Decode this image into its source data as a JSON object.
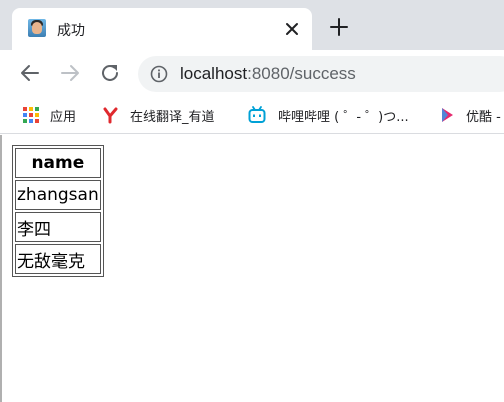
{
  "tab": {
    "title": "成功",
    "favicon": "avatar-icon"
  },
  "toolbar": {
    "url_host": "localhost",
    "url_rest": ":8080/success"
  },
  "bookmarks": [
    {
      "label": "应用",
      "icon": "apps-grid-icon"
    },
    {
      "label": "在线翻译_有道",
      "icon": "youdao-icon"
    },
    {
      "label": "哔哩哔哩 ( ゜- ゜)つ...",
      "icon": "bilibili-icon"
    },
    {
      "label": "优酷 -",
      "icon": "youku-icon"
    }
  ],
  "table": {
    "header": "name",
    "rows": [
      "zhangsan",
      "李四",
      "无敌毫克"
    ]
  },
  "colors": {
    "tabstrip": "#dee1e6",
    "omnibox": "#f1f3f4",
    "youdao": "#e0292e",
    "bilibili": "#00a1d6",
    "youku": "#e52a6f"
  }
}
